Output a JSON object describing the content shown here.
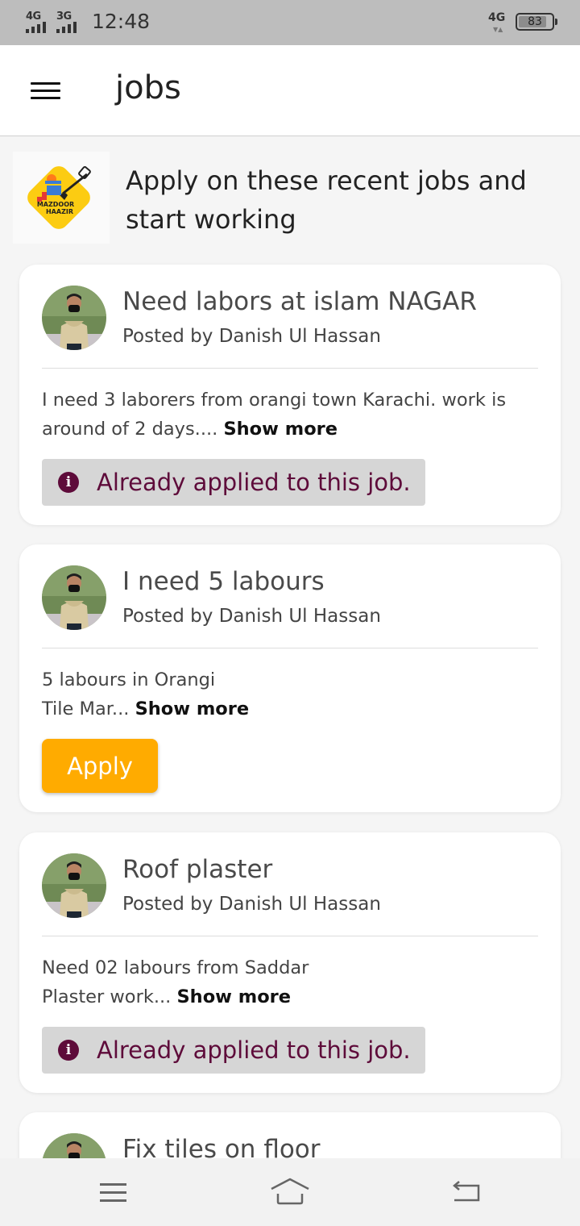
{
  "status_bar": {
    "network1": "4G",
    "network2": "3G",
    "time": "12:48",
    "network_right": "4G",
    "battery": "83"
  },
  "app_bar": {
    "menu_icon": "hamburger-icon",
    "title": "jobs"
  },
  "intro": {
    "logo_text_line1": "MAZDOOR",
    "logo_text_line2": "HAAZIR",
    "text": "Apply on these recent jobs and start working"
  },
  "jobs": [
    {
      "title": "Need labors at islam NAGAR",
      "author": "Posted by Danish Ul Hassan",
      "description": "I need 3 laborers from orangi town Karachi. work is around of 2 days....",
      "show_more": "Show more",
      "status": "Already applied to this job."
    },
    {
      "title": "I need 5 labours",
      "author": "Posted by Danish Ul Hassan",
      "description_line1": "5 labours in Orangi",
      "description_line2": "Tile Mar...",
      "show_more": "Show more",
      "apply_label": "Apply"
    },
    {
      "title": "Roof plaster",
      "author": "Posted by Danish Ul Hassan",
      "description_line1": "Need 02 labours from Saddar",
      "description_line2": "Plaster work...",
      "show_more": "Show more",
      "status": "Already applied to this job."
    },
    {
      "title": "Fix tiles on floor"
    }
  ],
  "colors": {
    "accent": "#ffab00",
    "applied_text": "#5e0b3a",
    "applied_bg": "#d6d6d6",
    "status_bar": "#bdbdbd"
  },
  "nav_bar": {
    "menu": "menu-icon",
    "home": "home-icon",
    "back": "back-icon"
  }
}
